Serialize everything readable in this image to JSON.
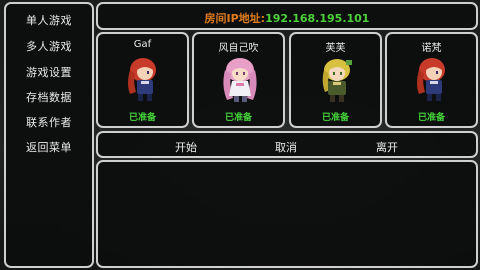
{
  "sidebar": {
    "items": [
      {
        "label": "单人游戏"
      },
      {
        "label": "多人游戏"
      },
      {
        "label": "游戏设置"
      },
      {
        "label": "存档数据"
      },
      {
        "label": "联系作者"
      },
      {
        "label": "返回菜单"
      }
    ]
  },
  "room": {
    "ip_label": "房间IP地址:",
    "ip_value": "192.168.195.101"
  },
  "players": [
    {
      "name": "Gaf",
      "status": "已准备",
      "hair_color": "#c83a2a"
    },
    {
      "name": "风自己吹",
      "status": "已准备",
      "hair_color": "#e8a0c8"
    },
    {
      "name": "芙芙",
      "status": "已准备",
      "hair_color": "#d8c040"
    },
    {
      "name": "诺梵",
      "status": "已准备",
      "hair_color": "#c83a2a"
    }
  ],
  "actions": {
    "start": "开始",
    "cancel": "取消",
    "leave": "离开"
  },
  "colors": {
    "ip_label": "#e07c1e",
    "ip_value": "#4cd13b",
    "ready": "#45d63a",
    "border": "#cfcfcf"
  }
}
